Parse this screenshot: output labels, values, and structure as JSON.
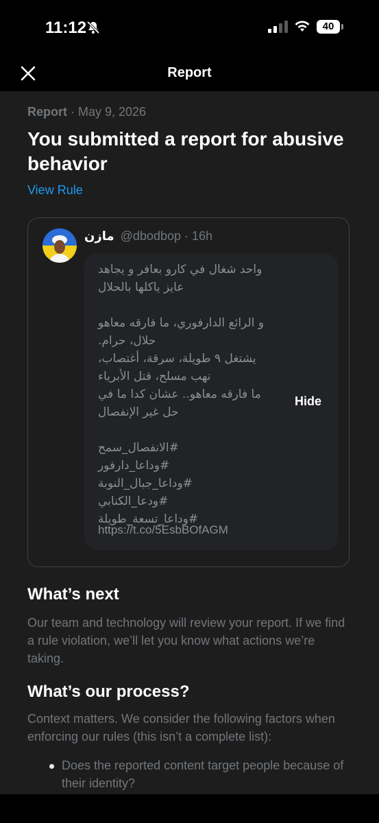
{
  "status": {
    "time": "11:12",
    "battery": "40",
    "icons": [
      "bell-slash-icon",
      "cellular-signal-icon",
      "wifi-icon",
      "battery-icon"
    ]
  },
  "nav": {
    "title": "Report",
    "close_icon": "close-icon"
  },
  "report": {
    "meta_label": "Report",
    "meta_separator": " · ",
    "meta_date": "May 9, 2026",
    "headline": "You submitted a report for abusive behavior",
    "view_rule": "View Rule"
  },
  "tweet": {
    "author_name": "مازن",
    "handle": "@dbodbop",
    "separator": " · ",
    "age": "16h",
    "text": "واحد شغال في كارو بعافر و يجاهد\nعايز ياكلها بالحلال\n\nو الرائع الدارفوري، ما فارقه معاهو\nحلال، حرام.\nيشتغل ٩ طويلة، سرقة، أغتصاب،\nنهب مسلح، قتل الأبرياء\nما فارقه معاهو.. عشان كدا ما في\nحل غير الإنفصال\n\n#الانفصال_سمح\n#وداعا_دارفور\n#وداعا_جبال_النوبة\n#ودعا_الكنابي\n#وداعا_تسعة_طويلة",
    "link": "https://t.co/5EsbBOfAGM",
    "hide_label": "Hide"
  },
  "whats_next": {
    "title": "What’s next",
    "body": "Our team and technology will review your report. If we find a rule violation, we’ll let you know what actions we’re taking."
  },
  "process": {
    "title": "What’s our process?",
    "body": "Context matters. We consider the following factors when enforcing our rules (this isn’t a complete list):",
    "bullets": [
      "Does the reported content target people because of their identity?"
    ]
  },
  "colors": {
    "accent": "#1d9bf0",
    "background": "#1d1d1d",
    "muted_text": "#71767b"
  }
}
